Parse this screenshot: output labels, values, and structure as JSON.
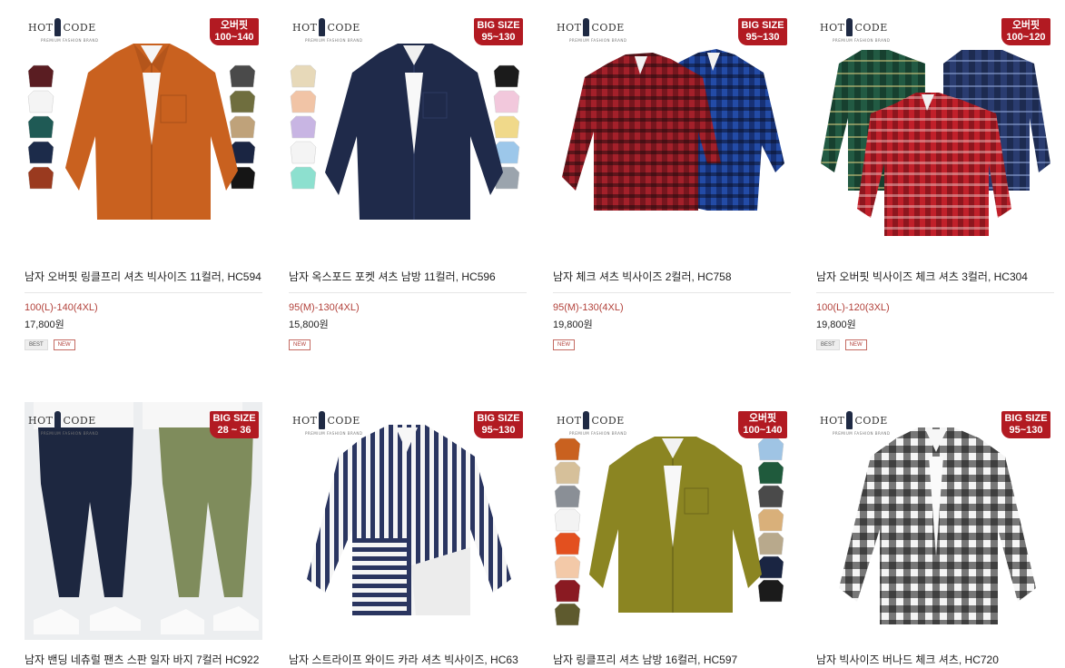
{
  "brand": {
    "logo_left": "HOT",
    "logo_right": "CODE",
    "logo_sub": "PREMIUM FASHION BRAND"
  },
  "products": [
    {
      "name": "남자 오버핏 링클프리 셔츠 빅사이즈 11컬러, HC594",
      "sizes": "100(L)-140(4XL)",
      "price": "17,800원",
      "badge": [
        "오버핏",
        "100~140"
      ],
      "tags": [
        "BEST",
        "NEW"
      ],
      "main_color": "#c9611f",
      "swatches_left": [
        "#5a1d22",
        "#f4f4f4",
        "#1f5a55",
        "#1c2b4a",
        "#9a3a1f"
      ],
      "swatches_right": [
        "#4a4a4a",
        "#6f6e3e",
        "#bfa27a",
        "#1a2542",
        "#151515"
      ]
    },
    {
      "name": "남자 옥스포드 포켓 셔츠 남방 11컬러, HC596",
      "sizes": "95(M)-130(4XL)",
      "price": "15,800원",
      "badge": [
        "BIG SIZE",
        "95~130"
      ],
      "tags": [
        "NEW"
      ],
      "main_color": "#1f2a4a",
      "swatches_left": [
        "#e7d9b9",
        "#f1c4a6",
        "#c8b5e3",
        "#f4f4f4",
        "#8de0cf"
      ],
      "swatches_right": [
        "#1b1b1b",
        "#f2c8dc",
        "#f0d98a",
        "#9cc7ea",
        "#9ba4ad"
      ]
    },
    {
      "name": "남자 체크 셔츠 빅사이즈 2컬러, HC758",
      "sizes": "95(M)-130(4XL)",
      "price": "19,800원",
      "badge": [
        "BIG SIZE",
        "95~130"
      ],
      "tags": [
        "NEW"
      ],
      "shirts": [
        "#a3202a",
        "#234ba6"
      ]
    },
    {
      "name": "남자 오버핏 빅사이즈 체크 셔츠 3컬러, HC304",
      "sizes": "100(L)-120(3XL)",
      "price": "19,800원",
      "badge": [
        "오버핏",
        "100~120"
      ],
      "tags": [
        "BEST",
        "NEW"
      ],
      "shirts": [
        "#225a43",
        "#2a3c70",
        "#c1202a"
      ]
    },
    {
      "name": "남자 밴딩 네츄럴 팬츠 스판 일자 바지 7컬러 HC922",
      "badge": [
        "BIG SIZE",
        "28 ~ 36"
      ],
      "pants": [
        "#1d2740",
        "#7f8c5c"
      ]
    },
    {
      "name": "남자 스트라이프 와이드 카라 셔츠 빅사이즈, HC63",
      "badge": [
        "BIG SIZE",
        "95~130"
      ],
      "main_color": "#2a3560"
    },
    {
      "name": "남자 링클프리 셔츠 남방 16컬러, HC597",
      "badge": [
        "오버핏",
        "100~140"
      ],
      "main_color": "#8b8522",
      "swatches_left": [
        "#c9611f",
        "#d6c09a",
        "#8a8f96",
        "#f3f3f3",
        "#e3501f",
        "#f3c9a8",
        "#8a1a22",
        "#5e5a2e"
      ],
      "swatches_right": [
        "#9fc4e4",
        "#1f5a3c",
        "#4a4a4a",
        "#d9b07a",
        "#b8a98c",
        "#1a2542",
        "#1b1b1b"
      ]
    },
    {
      "name": "남자 빅사이즈 버나드 체크 셔츠, HC720",
      "badge": [
        "BIG SIZE",
        "95~130"
      ],
      "main_color": "#111111"
    }
  ]
}
